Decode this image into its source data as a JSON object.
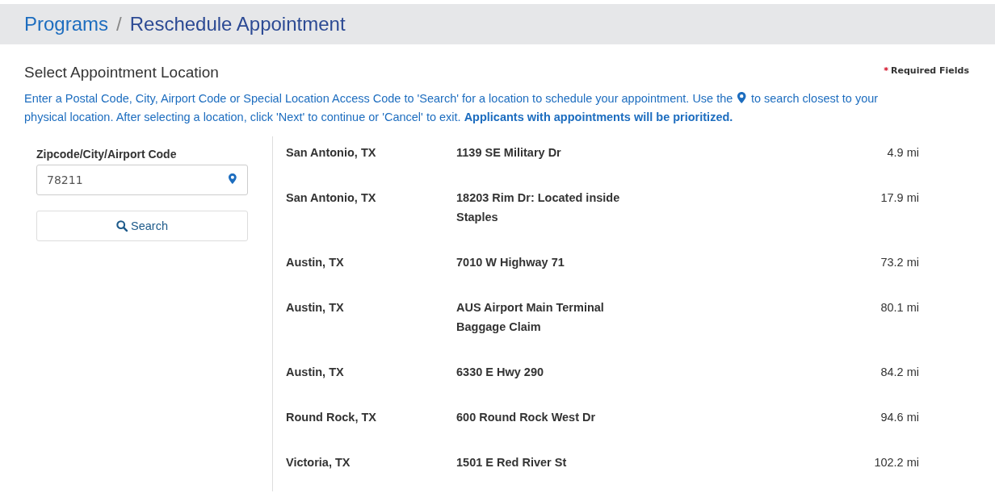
{
  "breadcrumb": [
    {
      "label": "Programs",
      "kind": "link"
    },
    {
      "label": "Reschedule Appointment",
      "kind": "current"
    }
  ],
  "breadcrumb_separator": "/",
  "section_title": "Select Appointment Location",
  "required_note": {
    "mark": "*",
    "label": "Required Fields"
  },
  "instructions": {
    "before_icon": "Enter a Postal Code, City, Airport Code or Special Location Access Code to 'Search' for a location to schedule your appointment. Use the",
    "after_icon": "to search closest to your",
    "second_line": "physical location. After selecting a location, click 'Next' to continue or 'Cancel' to exit.",
    "emphasis": "Applicants with appointments will be prioritized."
  },
  "search": {
    "label": "Zipcode/City/Airport Code",
    "value": "78211",
    "button": "Search"
  },
  "locations": [
    {
      "city": "San Antonio, TX",
      "address": "1139 SE Military Dr",
      "distance": "4.9 mi"
    },
    {
      "city": "San Antonio, TX",
      "address": "18203 Rim Dr: Located inside Staples",
      "distance": "17.9 mi"
    },
    {
      "city": "Austin, TX",
      "address": "7010 W Highway 71",
      "distance": "73.2 mi"
    },
    {
      "city": "Austin, TX",
      "address": "AUS Airport Main Terminal Baggage Claim",
      "distance": "80.1 mi"
    },
    {
      "city": "Austin, TX",
      "address": "6330 E Hwy 290",
      "distance": "84.2 mi"
    },
    {
      "city": "Round Rock, TX",
      "address": "600 Round Rock West Dr",
      "distance": "94.6 mi"
    },
    {
      "city": "Victoria, TX",
      "address": "1501 E Red River St",
      "distance": "102.2 mi"
    }
  ]
}
